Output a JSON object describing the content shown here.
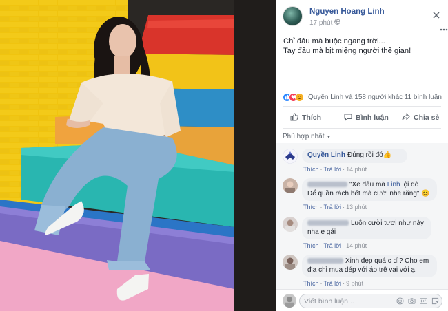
{
  "photo": {
    "alt_label": "photo"
  },
  "post": {
    "author": "Nguyen Hoang Linh",
    "time": "17 phút",
    "privacy_icon": "globe-icon",
    "caption": [
      "Chỉ đâu mà buộc ngang trời...",
      "Tay đâu mà bịt miệng người thế gian!"
    ],
    "more_icon": "ellipsis-icon",
    "close_icon": "close-icon"
  },
  "reactions": {
    "icons": [
      "like-icon",
      "love-icon",
      "haha-icon"
    ],
    "summary": "Quyền Linh và 158 người khác",
    "comments_count": "11 bình luận"
  },
  "actions": {
    "like": "Thích",
    "comment": "Bình luận",
    "share": "Chia sẻ"
  },
  "sort": {
    "label": "Phù hợp nhất"
  },
  "comments": [
    {
      "author": "Quyền Linh",
      "text": "Đúng rồi đó",
      "emoji": "👍",
      "like": "Thích",
      "reply": "Trả lời",
      "time": "14 phút"
    },
    {
      "author_hidden": true,
      "text_line1": "\"Xe đâu mà",
      "mention": "Linh",
      "text_line1_end": "lội dò",
      "text_line2": "Để quần rách hết mà cười nhe răng\"",
      "emoji": "😊",
      "like": "Thích",
      "reply": "Trả lời",
      "time": "13 phút"
    },
    {
      "author_hidden": true,
      "text_line1": "Luôn cười tươi như này",
      "text_line2": "nha e gái",
      "like": "Thích",
      "reply": "Trả lời",
      "time": "14 phút"
    },
    {
      "author_hidden": true,
      "text_line1": "Xinh đẹp quá c dì? Cho em",
      "text_line2": "địa chỉ mua dép với áo trễ vai với ạ.",
      "like": "Thích",
      "reply": "Trả lời",
      "time": "9 phút"
    }
  ],
  "composer": {
    "placeholder": "Viết bình luận...",
    "icons": [
      "emoji-icon",
      "camera-icon",
      "gif-icon",
      "sticker-icon"
    ]
  },
  "colors": {
    "link_blue": "#365899",
    "meta_grey": "#90949c",
    "bubble": "#edeff2"
  }
}
